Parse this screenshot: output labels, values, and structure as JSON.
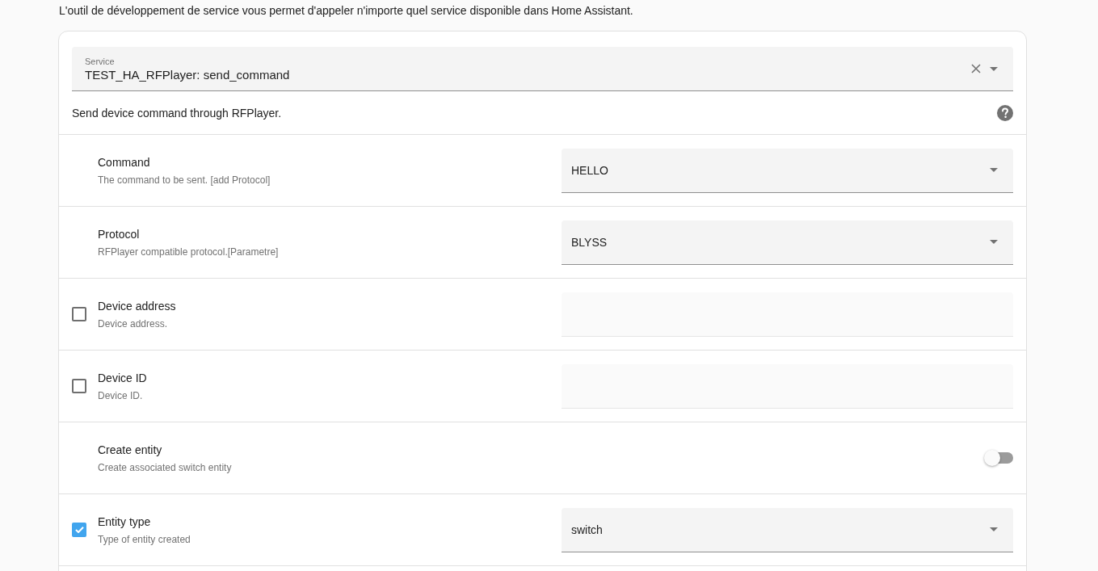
{
  "intro": "L'outil de développement de service vous permet d'appeler n'importe quel service disponible dans Home Assistant.",
  "service_field": {
    "label": "Service",
    "value": "TEST_HA_RFPlayer: send_command"
  },
  "service_description": "Send device command through RFPlayer.",
  "fields": [
    {
      "kind": "select",
      "label": "Command",
      "description": "The command to be sent. [add Protocol]",
      "value": "HELLO",
      "disabled": false
    },
    {
      "kind": "select",
      "label": "Protocol",
      "description": "RFPlayer compatible protocol.[Parametre]",
      "value": "BLYSS",
      "disabled": false
    },
    {
      "kind": "text",
      "label": "Device address",
      "description": "Device address.",
      "checked": false,
      "disabled": true
    },
    {
      "kind": "text",
      "label": "Device ID",
      "description": "Device ID.",
      "checked": false,
      "disabled": true
    },
    {
      "kind": "toggle",
      "label": "Create entity",
      "description": "Create associated switch entity",
      "on": false
    },
    {
      "kind": "select",
      "label": "Entity type",
      "description": "Type of entity created",
      "value": "switch",
      "checked": true,
      "disabled": false
    }
  ]
}
